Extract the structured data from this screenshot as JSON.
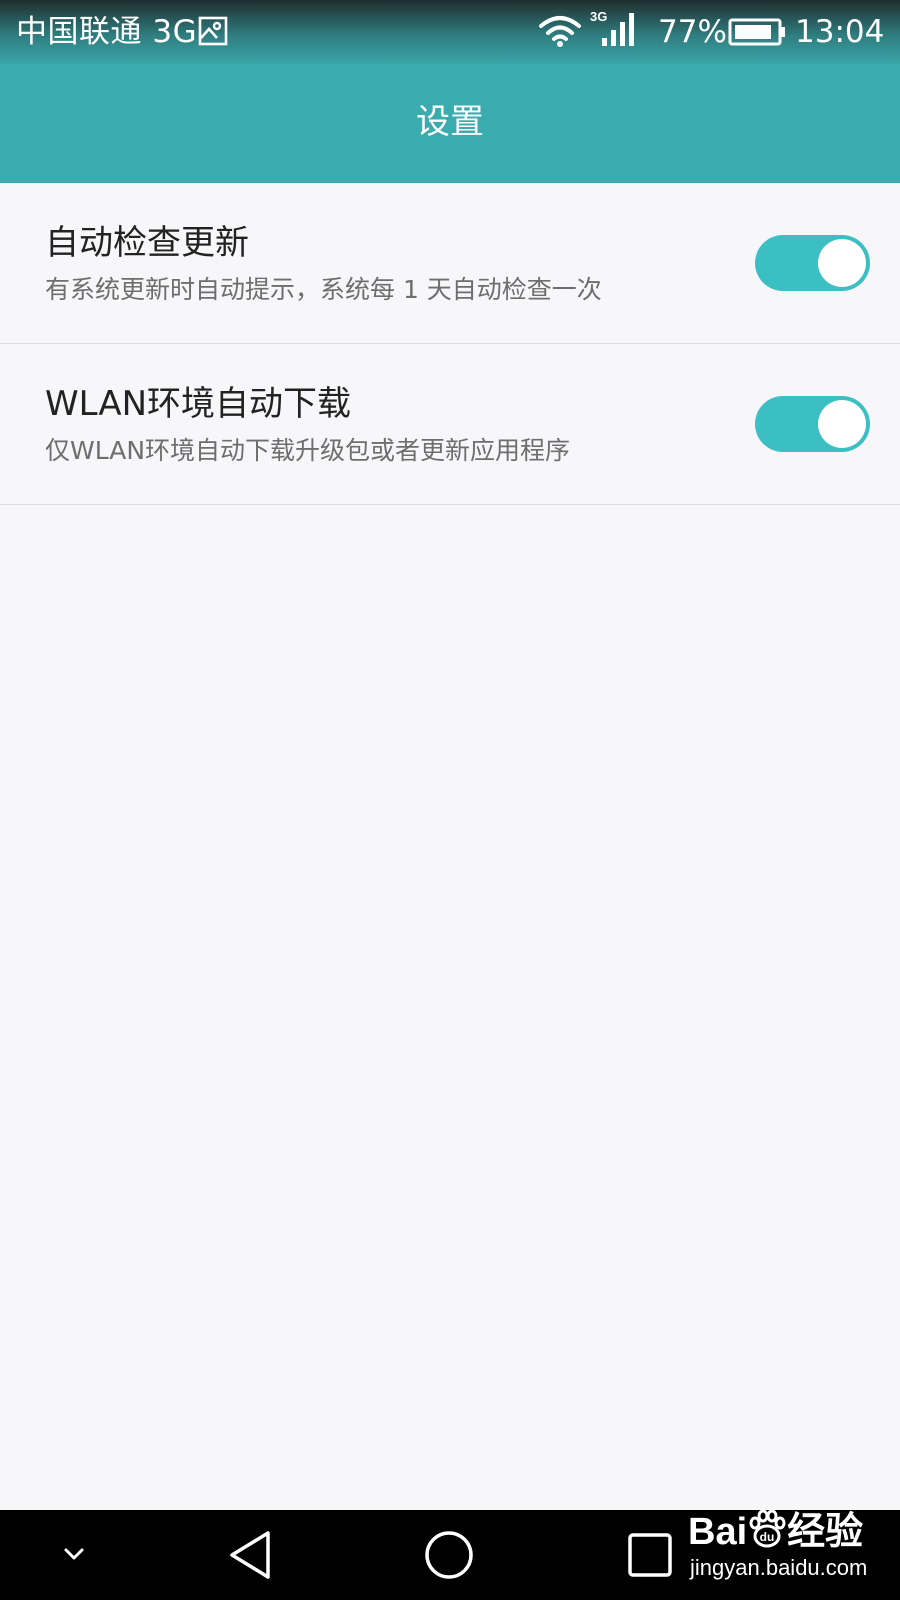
{
  "status_bar": {
    "carrier": "中国联通 3G",
    "network_badge": "3G",
    "battery_percent": "77%",
    "time": "13:04",
    "icons": [
      "gallery-icon",
      "wifi-icon",
      "signal-3g-icon",
      "battery-icon"
    ]
  },
  "header": {
    "title": "设置"
  },
  "settings": {
    "items": [
      {
        "title": "自动检查更新",
        "subtitle": "有系统更新时自动提示，系统每 1 天自动检查一次",
        "enabled": true
      },
      {
        "title": "WLAN环境自动下载",
        "subtitle": "仅WLAN环境自动下载升级包或者更新应用程序",
        "enabled": true
      }
    ]
  },
  "nav_bar": {
    "icons": [
      "chevron-down-icon",
      "back-icon",
      "home-icon",
      "recents-icon"
    ]
  },
  "watermark": {
    "brand_left": "Bai",
    "brand_mid": "du",
    "brand_right": "经验",
    "url": "jingyan.baidu.com"
  },
  "colors": {
    "accent": "#3aabae",
    "toggle_on": "#3bbfc3",
    "background": "#f7f6f9"
  }
}
